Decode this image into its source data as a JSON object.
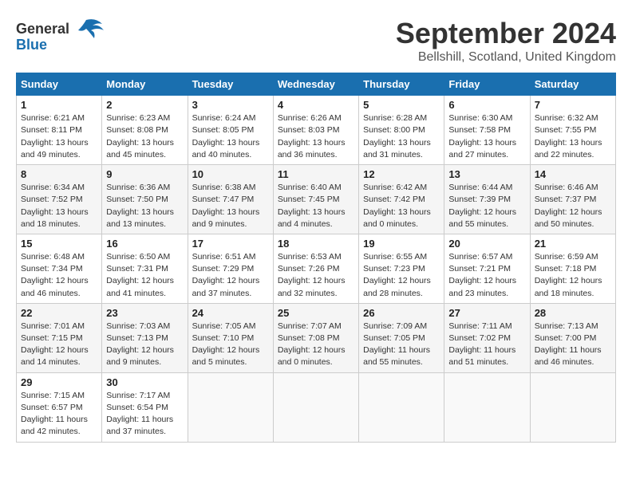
{
  "header": {
    "logo_general": "General",
    "logo_blue": "Blue",
    "month_title": "September 2024",
    "location": "Bellshill, Scotland, United Kingdom"
  },
  "weekdays": [
    "Sunday",
    "Monday",
    "Tuesday",
    "Wednesday",
    "Thursday",
    "Friday",
    "Saturday"
  ],
  "weeks": [
    [
      {
        "day": "1",
        "sunrise": "Sunrise: 6:21 AM",
        "sunset": "Sunset: 8:11 PM",
        "daylight": "Daylight: 13 hours and 49 minutes."
      },
      {
        "day": "2",
        "sunrise": "Sunrise: 6:23 AM",
        "sunset": "Sunset: 8:08 PM",
        "daylight": "Daylight: 13 hours and 45 minutes."
      },
      {
        "day": "3",
        "sunrise": "Sunrise: 6:24 AM",
        "sunset": "Sunset: 8:05 PM",
        "daylight": "Daylight: 13 hours and 40 minutes."
      },
      {
        "day": "4",
        "sunrise": "Sunrise: 6:26 AM",
        "sunset": "Sunset: 8:03 PM",
        "daylight": "Daylight: 13 hours and 36 minutes."
      },
      {
        "day": "5",
        "sunrise": "Sunrise: 6:28 AM",
        "sunset": "Sunset: 8:00 PM",
        "daylight": "Daylight: 13 hours and 31 minutes."
      },
      {
        "day": "6",
        "sunrise": "Sunrise: 6:30 AM",
        "sunset": "Sunset: 7:58 PM",
        "daylight": "Daylight: 13 hours and 27 minutes."
      },
      {
        "day": "7",
        "sunrise": "Sunrise: 6:32 AM",
        "sunset": "Sunset: 7:55 PM",
        "daylight": "Daylight: 13 hours and 22 minutes."
      }
    ],
    [
      {
        "day": "8",
        "sunrise": "Sunrise: 6:34 AM",
        "sunset": "Sunset: 7:52 PM",
        "daylight": "Daylight: 13 hours and 18 minutes."
      },
      {
        "day": "9",
        "sunrise": "Sunrise: 6:36 AM",
        "sunset": "Sunset: 7:50 PM",
        "daylight": "Daylight: 13 hours and 13 minutes."
      },
      {
        "day": "10",
        "sunrise": "Sunrise: 6:38 AM",
        "sunset": "Sunset: 7:47 PM",
        "daylight": "Daylight: 13 hours and 9 minutes."
      },
      {
        "day": "11",
        "sunrise": "Sunrise: 6:40 AM",
        "sunset": "Sunset: 7:45 PM",
        "daylight": "Daylight: 13 hours and 4 minutes."
      },
      {
        "day": "12",
        "sunrise": "Sunrise: 6:42 AM",
        "sunset": "Sunset: 7:42 PM",
        "daylight": "Daylight: 13 hours and 0 minutes."
      },
      {
        "day": "13",
        "sunrise": "Sunrise: 6:44 AM",
        "sunset": "Sunset: 7:39 PM",
        "daylight": "Daylight: 12 hours and 55 minutes."
      },
      {
        "day": "14",
        "sunrise": "Sunrise: 6:46 AM",
        "sunset": "Sunset: 7:37 PM",
        "daylight": "Daylight: 12 hours and 50 minutes."
      }
    ],
    [
      {
        "day": "15",
        "sunrise": "Sunrise: 6:48 AM",
        "sunset": "Sunset: 7:34 PM",
        "daylight": "Daylight: 12 hours and 46 minutes."
      },
      {
        "day": "16",
        "sunrise": "Sunrise: 6:50 AM",
        "sunset": "Sunset: 7:31 PM",
        "daylight": "Daylight: 12 hours and 41 minutes."
      },
      {
        "day": "17",
        "sunrise": "Sunrise: 6:51 AM",
        "sunset": "Sunset: 7:29 PM",
        "daylight": "Daylight: 12 hours and 37 minutes."
      },
      {
        "day": "18",
        "sunrise": "Sunrise: 6:53 AM",
        "sunset": "Sunset: 7:26 PM",
        "daylight": "Daylight: 12 hours and 32 minutes."
      },
      {
        "day": "19",
        "sunrise": "Sunrise: 6:55 AM",
        "sunset": "Sunset: 7:23 PM",
        "daylight": "Daylight: 12 hours and 28 minutes."
      },
      {
        "day": "20",
        "sunrise": "Sunrise: 6:57 AM",
        "sunset": "Sunset: 7:21 PM",
        "daylight": "Daylight: 12 hours and 23 minutes."
      },
      {
        "day": "21",
        "sunrise": "Sunrise: 6:59 AM",
        "sunset": "Sunset: 7:18 PM",
        "daylight": "Daylight: 12 hours and 18 minutes."
      }
    ],
    [
      {
        "day": "22",
        "sunrise": "Sunrise: 7:01 AM",
        "sunset": "Sunset: 7:15 PM",
        "daylight": "Daylight: 12 hours and 14 minutes."
      },
      {
        "day": "23",
        "sunrise": "Sunrise: 7:03 AM",
        "sunset": "Sunset: 7:13 PM",
        "daylight": "Daylight: 12 hours and 9 minutes."
      },
      {
        "day": "24",
        "sunrise": "Sunrise: 7:05 AM",
        "sunset": "Sunset: 7:10 PM",
        "daylight": "Daylight: 12 hours and 5 minutes."
      },
      {
        "day": "25",
        "sunrise": "Sunrise: 7:07 AM",
        "sunset": "Sunset: 7:08 PM",
        "daylight": "Daylight: 12 hours and 0 minutes."
      },
      {
        "day": "26",
        "sunrise": "Sunrise: 7:09 AM",
        "sunset": "Sunset: 7:05 PM",
        "daylight": "Daylight: 11 hours and 55 minutes."
      },
      {
        "day": "27",
        "sunrise": "Sunrise: 7:11 AM",
        "sunset": "Sunset: 7:02 PM",
        "daylight": "Daylight: 11 hours and 51 minutes."
      },
      {
        "day": "28",
        "sunrise": "Sunrise: 7:13 AM",
        "sunset": "Sunset: 7:00 PM",
        "daylight": "Daylight: 11 hours and 46 minutes."
      }
    ],
    [
      {
        "day": "29",
        "sunrise": "Sunrise: 7:15 AM",
        "sunset": "Sunset: 6:57 PM",
        "daylight": "Daylight: 11 hours and 42 minutes."
      },
      {
        "day": "30",
        "sunrise": "Sunrise: 7:17 AM",
        "sunset": "Sunset: 6:54 PM",
        "daylight": "Daylight: 11 hours and 37 minutes."
      },
      null,
      null,
      null,
      null,
      null
    ]
  ]
}
